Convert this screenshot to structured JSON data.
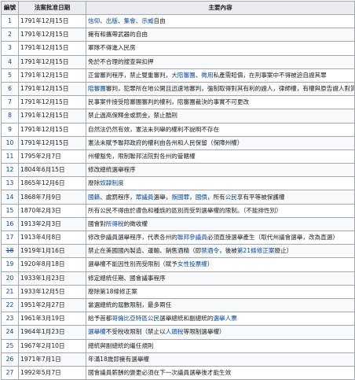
{
  "table": {
    "headers": {
      "num": "編號",
      "date": "法案批准日期",
      "content": "主要內容"
    },
    "rows": [
      {
        "num": "1",
        "date": "1791年12月15日",
        "segments": [
          {
            "t": "信仰",
            "link": true
          },
          {
            "t": "、"
          },
          {
            "t": "出版",
            "link": true
          },
          {
            "t": "、"
          },
          {
            "t": "集會",
            "link": true
          },
          {
            "t": "、"
          },
          {
            "t": "示威",
            "link": true
          },
          {
            "t": "自由"
          }
        ]
      },
      {
        "num": "2",
        "date": "1791年12月15日",
        "segments": [
          {
            "t": "擁有和攜帶武器的自由"
          }
        ]
      },
      {
        "num": "3",
        "date": "1791年12月15日",
        "segments": [
          {
            "t": "軍隊不得進入民房"
          }
        ]
      },
      {
        "num": "4",
        "date": "1791年12月15日",
        "segments": [
          {
            "t": "免於不合理的搜查與扣押"
          }
        ]
      },
      {
        "num": "5",
        "date": "1791年12月15日",
        "segments": [
          {
            "t": "正當審判程序，禁止雙重審判，"
          },
          {
            "t": "大陪審團",
            "link": true
          },
          {
            "t": "、"
          },
          {
            "t": "徵用",
            "link": true
          },
          {
            "t": "私產需賠償，在刑事案中不得被迫自證其罪"
          }
        ]
      },
      {
        "num": "6",
        "date": "1791年12月15日",
        "segments": [
          {
            "t": "陪審團",
            "link": true
          },
          {
            "t": "審判，犯罪所在地公開且迅速地審判，強制取得對其有利的證人，律師權，有權與原告證人對質"
          }
        ]
      },
      {
        "num": "7",
        "date": "1791年12月15日",
        "segments": [
          {
            "t": "民事案件接受陪審團審判的權利，陪審團裁決的事實不可更改"
          }
        ]
      },
      {
        "num": "8",
        "date": "1791年12月15日",
        "segments": [
          {
            "t": "禁止過高保釋金或罰金，禁止酷刑"
          }
        ]
      },
      {
        "num": "9",
        "date": "1791年12月15日",
        "segments": [
          {
            "t": "自然法仍然有效，憲法未列舉的權利不說明不存在"
          }
        ]
      },
      {
        "num": "10",
        "date": "1791年12月15日",
        "segments": [
          {
            "t": "憲法未賦予聯邦政府的權利由各州和人民保留（保障州權）"
          }
        ]
      },
      {
        "num": "11",
        "date": "1795年2月7日",
        "segments": [
          {
            "t": "州權豁免，限制聯邦法院對各州的管轄權"
          }
        ]
      },
      {
        "num": "12",
        "date": "1804年6月15日",
        "segments": [
          {
            "t": "修改總統選舉程序"
          }
        ]
      },
      {
        "num": "13",
        "date": "1865年12月6日",
        "segments": [
          {
            "t": "廢除"
          },
          {
            "t": "奴隸制度",
            "link": true
          }
        ]
      },
      {
        "num": "14",
        "date": "1868年7月9日",
        "segments": [
          {
            "t": "國籍",
            "link": true
          },
          {
            "t": "、處罰程序，"
          },
          {
            "t": "眾議員",
            "link": true
          },
          {
            "t": "選舉，"
          },
          {
            "t": "叛國罪",
            "link": true
          },
          {
            "t": "，"
          },
          {
            "t": "國債",
            "link": true
          },
          {
            "t": "，所有"
          },
          {
            "t": "公民",
            "link": true
          },
          {
            "t": "享有平等被保護權"
          }
        ]
      },
      {
        "num": "15",
        "date": "1870年2月3日",
        "segments": [
          {
            "t": "所有公民不得由於膚色和種族的區別而受到選舉權的限制。（不能排性別）"
          }
        ]
      },
      {
        "num": "16",
        "date": "1913年2月3日",
        "segments": [
          {
            "t": "國會對"
          },
          {
            "t": "所得稅",
            "link": true
          },
          {
            "t": "的徵收權"
          }
        ]
      },
      {
        "num": "17",
        "date": "1913年4月8日",
        "segments": [
          {
            "t": "修改參議員選舉程序，代表各州的"
          },
          {
            "t": "聯邦參議員",
            "link": true
          },
          {
            "t": "必須直接選舉產生（取代州議會選舉，改為直選）"
          }
        ]
      },
      {
        "num": "18",
        "strike": true,
        "date": "1919年1月16日",
        "segments": [
          {
            "t": "禁止在美國國內製造、運輸、銷售酒精（即"
          },
          {
            "t": "禁酒令",
            "link": true
          },
          {
            "t": "，後被"
          },
          {
            "t": "第21條修正案",
            "link": true
          },
          {
            "t": "廢止）"
          }
        ]
      },
      {
        "num": "19",
        "date": "1920年8月18日",
        "segments": [
          {
            "t": "選舉權不能因性別而受限制（賦予"
          },
          {
            "t": "女性投票權",
            "link": true
          },
          {
            "t": "）"
          }
        ]
      },
      {
        "num": "20",
        "date": "1933年1月23日",
        "segments": [
          {
            "t": "修定總統任期、國會議事程序"
          }
        ]
      },
      {
        "num": "21",
        "date": "1933年12月5日",
        "segments": [
          {
            "t": "廢除第18條修正案"
          }
        ]
      },
      {
        "num": "22",
        "date": "1951年2月27日",
        "segments": [
          {
            "t": "當選總統的屆數限制，最多兩任"
          }
        ]
      },
      {
        "num": "23",
        "date": "1961年3月19日",
        "segments": [
          {
            "t": "給予首都"
          },
          {
            "t": "哥倫比亞特區公民",
            "link": true
          },
          {
            "t": "選舉總統和副總統的"
          },
          {
            "t": "選舉人票",
            "link": true
          }
        ]
      },
      {
        "num": "24",
        "date": "1964年1月23日",
        "segments": [
          {
            "t": "選舉權",
            "link": true
          },
          {
            "t": "不受稅收限制（禁止以"
          },
          {
            "t": "人頭稅",
            "link": true
          },
          {
            "t": "等限制選舉權）"
          }
        ]
      },
      {
        "num": "25",
        "date": "1967年2月10日",
        "segments": [
          {
            "t": "總統與副總統的繼任規則"
          }
        ]
      },
      {
        "num": "26",
        "date": "1971年7月1日",
        "segments": [
          {
            "t": "年滿18歲即擁有選舉權"
          }
        ]
      },
      {
        "num": "27",
        "date": "1992年5月7日",
        "segments": [
          {
            "t": "國會議員薪酬的變更必須在下一次議員選舉後才能生效"
          }
        ]
      }
    ]
  },
  "colors": {
    "link": "#0645ad",
    "header_bg": "#eaecf0",
    "border": "#a2a9b1",
    "text": "#202122"
  }
}
